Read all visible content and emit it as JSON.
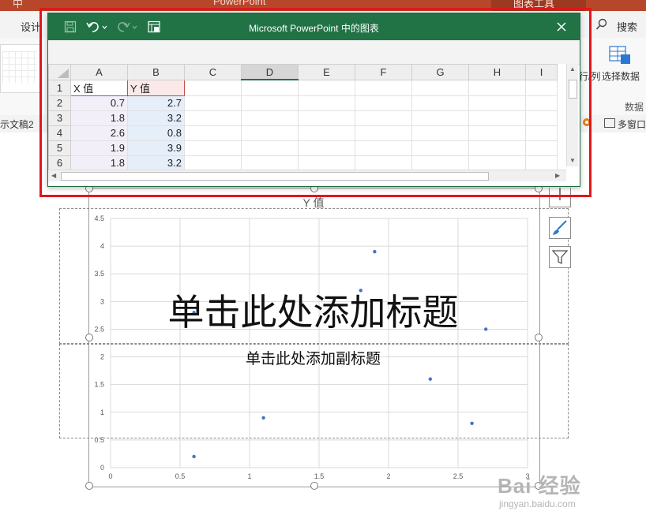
{
  "powerpoint": {
    "title_fragment": "PowerPoint",
    "ribbon_glyph": "中",
    "context_tab": "图表工具",
    "tab_design": "设计",
    "search_label": "搜索",
    "rowcol_label": "行/列",
    "select_data_label": "选择数据",
    "group_data_label": "数据",
    "doc_tab": "示文稿2",
    "multiwin_label": "多窗口"
  },
  "sheet_window": {
    "title": "Microsoft PowerPoint 中的图表",
    "columns": [
      "A",
      "B",
      "C",
      "D",
      "E",
      "F",
      "G",
      "H",
      "I"
    ],
    "selected_column": "D",
    "rows": [
      {
        "n": "1",
        "a": "X 值",
        "b": "Y 值"
      },
      {
        "n": "2",
        "a": "0.7",
        "b": "2.7"
      },
      {
        "n": "3",
        "a": "1.8",
        "b": "3.2"
      },
      {
        "n": "4",
        "a": "2.6",
        "b": "0.8"
      },
      {
        "n": "5",
        "a": "1.9",
        "b": "3.9"
      },
      {
        "n": "6",
        "a": "1.8",
        "b": "3.2"
      }
    ]
  },
  "slide": {
    "title_placeholder": "单击此处添加标题",
    "subtitle_placeholder": "单击此处添加副标题"
  },
  "watermark": {
    "main": "Bai 经验",
    "sub": "jingyan.baidu.com"
  },
  "colors": {
    "excel_green": "#217346",
    "ppt_red": "#b7472a",
    "highlight_red": "#e0161c",
    "point_blue": "#4472c4"
  },
  "chart_data": {
    "type": "scatter",
    "title": "Y 值",
    "xlim": [
      0,
      3
    ],
    "ylim": [
      0,
      4.5
    ],
    "x_ticks": [
      "0",
      "0.5",
      "1",
      "1.5",
      "2",
      "2.5",
      "3"
    ],
    "y_ticks": [
      "0",
      "0.5",
      "1",
      "1.5",
      "2",
      "2.5",
      "3",
      "3.5",
      "4",
      "4.5"
    ],
    "grid": true,
    "series": [
      {
        "points": [
          {
            "x": 0.6,
            "y": 0.2
          },
          {
            "x": 0.6,
            "y": 2.8
          },
          {
            "x": 1.1,
            "y": 0.9
          },
          {
            "x": 1.8,
            "y": 3.2
          },
          {
            "x": 1.9,
            "y": 3.9
          },
          {
            "x": 2.3,
            "y": 1.6
          },
          {
            "x": 2.6,
            "y": 0.8
          },
          {
            "x": 2.7,
            "y": 2.5
          }
        ]
      }
    ]
  }
}
